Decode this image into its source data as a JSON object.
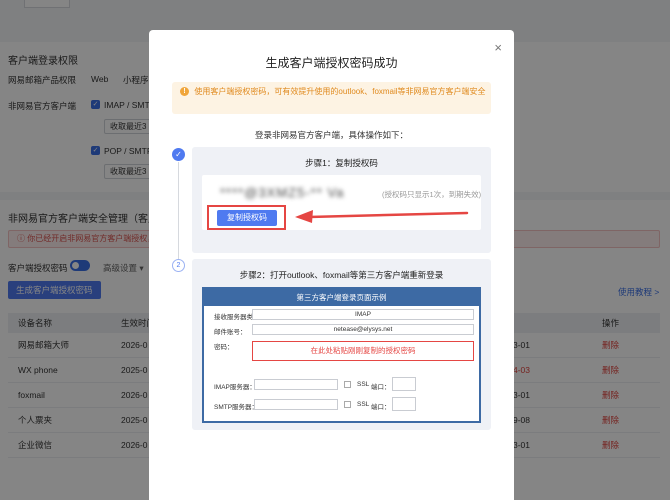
{
  "background": {
    "section_title": "客户端登录权限",
    "row1_label": "网易邮箱产品权限",
    "row1_web": "Web",
    "row1_mini": "小程序",
    "row2_label": "非网易官方客户端",
    "imap_label": "IMAP / SMTP",
    "imap_sub": "收取最近3",
    "pop_label": "POP / SMTP",
    "pop_sub": "收取最近3",
    "mgmt_title": "非网易官方客户端安全管理（客户",
    "alert_text": "你已经开启非网易官方客户端授权，可",
    "toggle_label": "客户端授权密码",
    "advanced_label": "高级设置 ▾",
    "generate_button": "生成客户端授权密码",
    "help_link": "使用教程 >",
    "table": {
      "headers": [
        "设备名称",
        "生效时间",
        "",
        "操作"
      ],
      "rows": [
        {
          "name": "网易邮箱大师",
          "time": "2026-0",
          "date": "3-01",
          "date_red": false,
          "action": "删除"
        },
        {
          "name": "WX phone",
          "time": "2025-0",
          "date": "4-03",
          "date_red": true,
          "action": "删除"
        },
        {
          "name": "foxmail",
          "time": "2026-0",
          "date": "3-01",
          "date_red": false,
          "action": "删除"
        },
        {
          "name": "个人票夹",
          "time": "2025-0",
          "date": "9-08",
          "date_red": false,
          "action": "删除"
        },
        {
          "name": "企业微信",
          "time": "2026-0",
          "date": "3-01",
          "date_red": false,
          "action": "删除"
        }
      ]
    }
  },
  "modal": {
    "title": "生成客户端授权密码成功",
    "close_icon": "×",
    "warning": "使用客户端授权密码，可有效提升使用的outlook、foxmail等非网易官方客户端安全",
    "intro": "登录非网易官方客户端，具体操作如下：",
    "step1": {
      "number": "✓",
      "title": "步骤1：复制授权码",
      "password_masked": "****@3XMZ5-**  Va",
      "hint": "(授权码只显示1次，到期失效)",
      "copy_button": "复制授权码"
    },
    "step2": {
      "number": "2",
      "title": "步骤2：打开outlook、foxmail等第三方客户端重新登录",
      "demo": {
        "header": "第三方客户端登录页面示例",
        "type_label": "接收服务器类型：",
        "type_value": "IMAP",
        "account_label": "邮件账号：",
        "account_value": "netease@elysys.net",
        "password_label": "密码：",
        "password_placeholder": "在此处粘贴刚刚复制的授权密码",
        "imap_label": "IMAP服务器：",
        "smtp_label": "SMTP服务器：",
        "ssl_label": "SSL",
        "port_label": "端口："
      }
    }
  },
  "colors": {
    "primary": "#4f7af0",
    "danger": "#e54643",
    "warning_bg": "#fdf3e3",
    "warning_text": "#e08a1e",
    "demo_header": "#3d6aa4"
  }
}
